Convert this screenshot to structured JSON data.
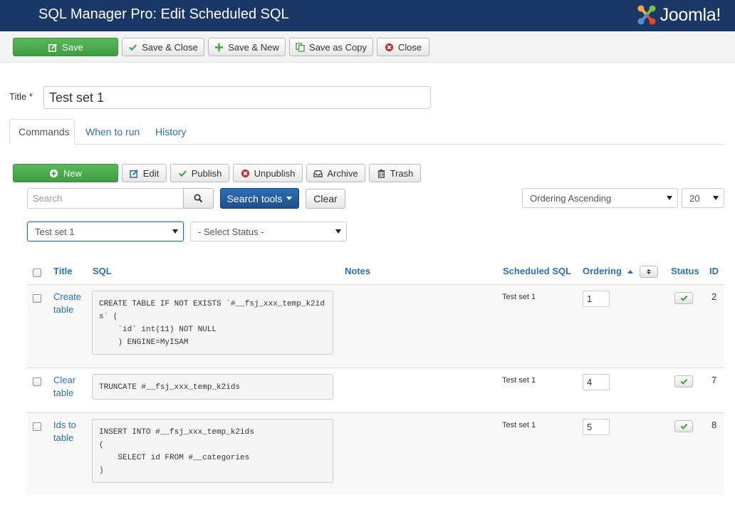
{
  "header": {
    "title": "SQL Manager Pro: Edit Scheduled SQL",
    "logo_text": "Joomla!"
  },
  "toolbar": {
    "save": "Save",
    "save_close": "Save & Close",
    "save_new": "Save & New",
    "save_copy": "Save as Copy",
    "close": "Close"
  },
  "form": {
    "title_label": "Title *",
    "title_value": "Test set 1"
  },
  "tabs": [
    "Commands",
    "When to run",
    "History"
  ],
  "list_toolbar": {
    "new": "New",
    "edit": "Edit",
    "publish": "Publish",
    "unpublish": "Unpublish",
    "archive": "Archive",
    "trash": "Trash"
  },
  "filters": {
    "search_placeholder": "Search",
    "search_tools": "Search tools",
    "clear": "Clear",
    "ordering": "Ordering Ascending",
    "limit": "20",
    "set_filter": "Test set 1",
    "status_filter": "- Select Status -"
  },
  "table": {
    "headers": {
      "title": "Title",
      "sql": "SQL",
      "notes": "Notes",
      "scheduled": "Scheduled SQL",
      "ordering": "Ordering",
      "status": "Status",
      "id": "ID"
    },
    "rows": [
      {
        "title": "Create table",
        "sql": "CREATE TABLE IF NOT EXISTS `#__fsj_xxx_temp_k2id\ns` (\n    `id` int(11) NOT NULL\n    ) ENGINE=MyISAM",
        "notes": "",
        "scheduled": "Test set 1",
        "ordering": "1",
        "id": "2"
      },
      {
        "title": "Clear table",
        "sql": "TRUNCATE #__fsj_xxx_temp_k2ids",
        "notes": "",
        "scheduled": "Test set 1",
        "ordering": "4",
        "id": "7"
      },
      {
        "title": "Ids to table",
        "sql": "INSERT INTO #__fsj_xxx_temp_k2ids\n(\n    SELECT id FROM #__categories\n)",
        "notes": "",
        "scheduled": "Test set 1",
        "ordering": "5",
        "id": "8"
      }
    ]
  },
  "colors": {
    "header_bg": "#1a3867",
    "success": "#46a546",
    "primary": "#2d6db5",
    "link": "#2a6fb5"
  }
}
